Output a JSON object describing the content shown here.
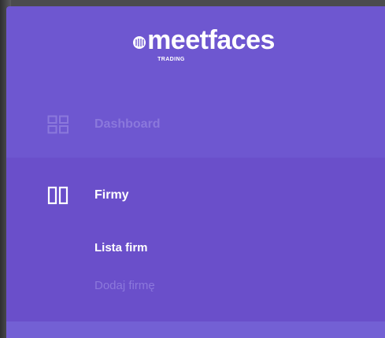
{
  "brand": {
    "name": "meetfaces",
    "subtitle": "TRADING",
    "logo_icon": "meetfaces-logo-icon"
  },
  "colors": {
    "sidebar_bg": "#6e57d0",
    "active_section_bg": "#6a4fca",
    "active_text": "#ffffff",
    "muted_text": "#8b78dc"
  },
  "nav": {
    "dashboard": {
      "label": "Dashboard",
      "icon": "grid-icon",
      "active": false
    },
    "firmy": {
      "label": "Firmy",
      "icon": "columns-icon",
      "active": true,
      "children": [
        {
          "label": "Lista firm",
          "active": true
        },
        {
          "label": "Dodaj firmę",
          "active": false
        }
      ]
    }
  }
}
